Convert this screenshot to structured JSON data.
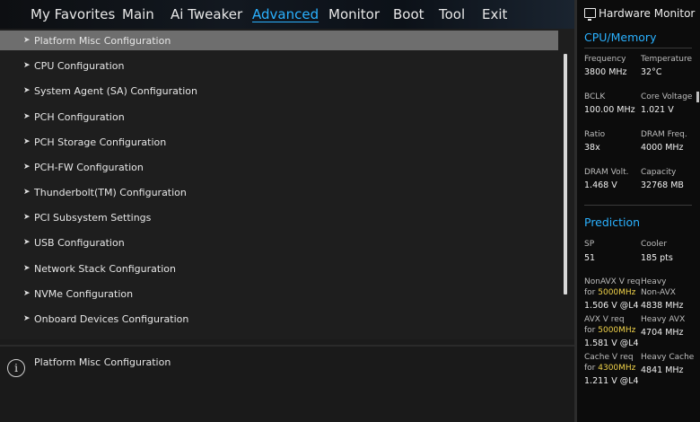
{
  "nav": {
    "tabs": [
      {
        "label": "My Favorites",
        "active": false
      },
      {
        "label": "Main",
        "active": false
      },
      {
        "label": "Ai Tweaker",
        "active": false
      },
      {
        "label": "Advanced",
        "active": true
      },
      {
        "label": "Monitor",
        "active": false
      },
      {
        "label": "Boot",
        "active": false
      },
      {
        "label": "Tool",
        "active": false
      },
      {
        "label": "Exit",
        "active": false
      }
    ]
  },
  "menu": {
    "items": [
      {
        "label": "Platform Misc Configuration",
        "selected": true
      },
      {
        "label": "CPU Configuration",
        "selected": false
      },
      {
        "label": "System Agent (SA) Configuration",
        "selected": false
      },
      {
        "label": "PCH Configuration",
        "selected": false
      },
      {
        "label": "PCH Storage Configuration",
        "selected": false
      },
      {
        "label": "PCH-FW Configuration",
        "selected": false
      },
      {
        "label": "Thunderbolt(TM) Configuration",
        "selected": false
      },
      {
        "label": "PCI Subsystem Settings",
        "selected": false
      },
      {
        "label": "USB Configuration",
        "selected": false
      },
      {
        "label": "Network Stack Configuration",
        "selected": false
      },
      {
        "label": "NVMe Configuration",
        "selected": false
      },
      {
        "label": "Onboard Devices Configuration",
        "selected": false
      }
    ]
  },
  "help": {
    "icon": "info-icon",
    "text": "Platform Misc Configuration"
  },
  "hardware_monitor": {
    "title": "Hardware Monitor",
    "cpu_memory": {
      "title": "CPU/Memory",
      "frequency_label": "Frequency",
      "frequency_value": "3800 MHz",
      "temperature_label": "Temperature",
      "temperature_value": "32°C",
      "bclk_label": "BCLK",
      "bclk_value": "100.00 MHz",
      "core_voltage_label": "Core Voltage",
      "core_voltage_value": "1.021 V",
      "ratio_label": "Ratio",
      "ratio_value": "38x",
      "dram_freq_label": "DRAM Freq.",
      "dram_freq_value": "4000 MHz",
      "dram_volt_label": "DRAM Volt.",
      "dram_volt_value": "1.468 V",
      "capacity_label": "Capacity",
      "capacity_value": "32768 MB"
    },
    "prediction": {
      "title": "Prediction",
      "sp_label": "SP",
      "sp_value": "51",
      "cooler_label": "Cooler",
      "cooler_value": "185 pts",
      "nonavx_label1": "NonAVX V req",
      "nonavx_label2": "for",
      "nonavx_freq": "5000MHz",
      "nonavx_value": "1.506 V @L4",
      "heavy_nonavx_label1": "Heavy",
      "heavy_nonavx_label2": "Non-AVX",
      "heavy_nonavx_value": "4838 MHz",
      "avx_label1": "AVX V req",
      "avx_label2": "for",
      "avx_freq": "5000MHz",
      "avx_value": "1.581 V @L4",
      "heavy_avx_label": "Heavy AVX",
      "heavy_avx_value": "4704 MHz",
      "cache_label1": "Cache V req",
      "cache_label2": "for",
      "cache_freq": "4300MHz",
      "cache_value": "1.211 V @L4",
      "heavy_cache_label": "Heavy Cache",
      "heavy_cache_value": "4841 MHz"
    }
  },
  "colors": {
    "accent": "#2ab1ff",
    "highlight": "#f2d44a",
    "selected_row": "#6e6e6e"
  }
}
